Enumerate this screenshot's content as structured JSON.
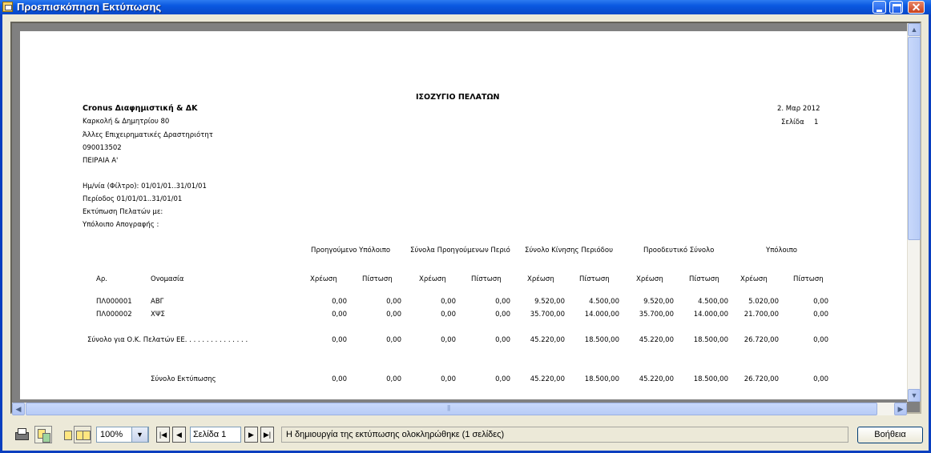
{
  "window": {
    "title": "Προεπισκόπηση Εκτύπωσης"
  },
  "report": {
    "title": "ΙΣΟΖΥΓΙΟ ΠΕΛΑΤΩΝ",
    "company": "Cronus Διαφημιστική & ΔΚ",
    "address": "Καρκολή & Δημητρίου 80",
    "activity": "Άλλες Επιχειρηματικές Δραστηριότητ",
    "vat": "090013502",
    "tax_office": "ΠΕΙΡΑΙΑ Α'",
    "date": "2. Μαρ 2012",
    "page_label": "Σελίδα",
    "page_no": "1",
    "filter_date": "Ημ/νία (Φίλτρο): 01/01/01..31/01/01",
    "period": "Περίοδος 01/01/01..31/01/01",
    "print_customers": "Εκτύπωση Πελατών με:",
    "stock_balance": "Υπόλοιπο Απογραφής :",
    "group_headers": [
      "Προηγούμενο Υπόλοιπο",
      "Σύνολα Προηγούμενων Περιό",
      "Σύνολο Κίνησης Περιόδου",
      "Προοδευτικό Σύνολο",
      "Υπόλοιπο"
    ],
    "col_no": "Αρ.",
    "col_name": "Ονομασία",
    "debit": "Χρέωση",
    "credit": "Πίστωση",
    "rows": [
      {
        "no": "ΠΛ000001",
        "name": "ΑΒΓ",
        "values": [
          "0,00",
          "0,00",
          "0,00",
          "0,00",
          "9.520,00",
          "4.500,00",
          "9.520,00",
          "4.500,00",
          "5.020,00",
          "0,00"
        ]
      },
      {
        "no": "ΠΛ000002",
        "name": "ΧΨΣ",
        "values": [
          "0,00",
          "0,00",
          "0,00",
          "0,00",
          "35.700,00",
          "14.000,00",
          "35.700,00",
          "14.000,00",
          "21.700,00",
          "0,00"
        ]
      }
    ],
    "group_total": {
      "label": "Σύνολο για Ο.Κ. Πελατών ΕΕ. . . . . . . . . . . . . . .",
      "values": [
        "0,00",
        "0,00",
        "0,00",
        "0,00",
        "45.220,00",
        "18.500,00",
        "45.220,00",
        "18.500,00",
        "26.720,00",
        "0,00"
      ]
    },
    "print_total": {
      "label": "Σύνολο Εκτύπωσης",
      "values": [
        "0,00",
        "0,00",
        "0,00",
        "0,00",
        "45.220,00",
        "18.500,00",
        "45.220,00",
        "18.500,00",
        "26.720,00",
        "0,00"
      ]
    }
  },
  "toolbar": {
    "zoom": "100%",
    "page": "Σελίδα 1",
    "status": "Η δημιουργία της εκτύπωσης ολοκληρώθηκε (1 σελίδες)",
    "help": "Βοήθεια"
  }
}
